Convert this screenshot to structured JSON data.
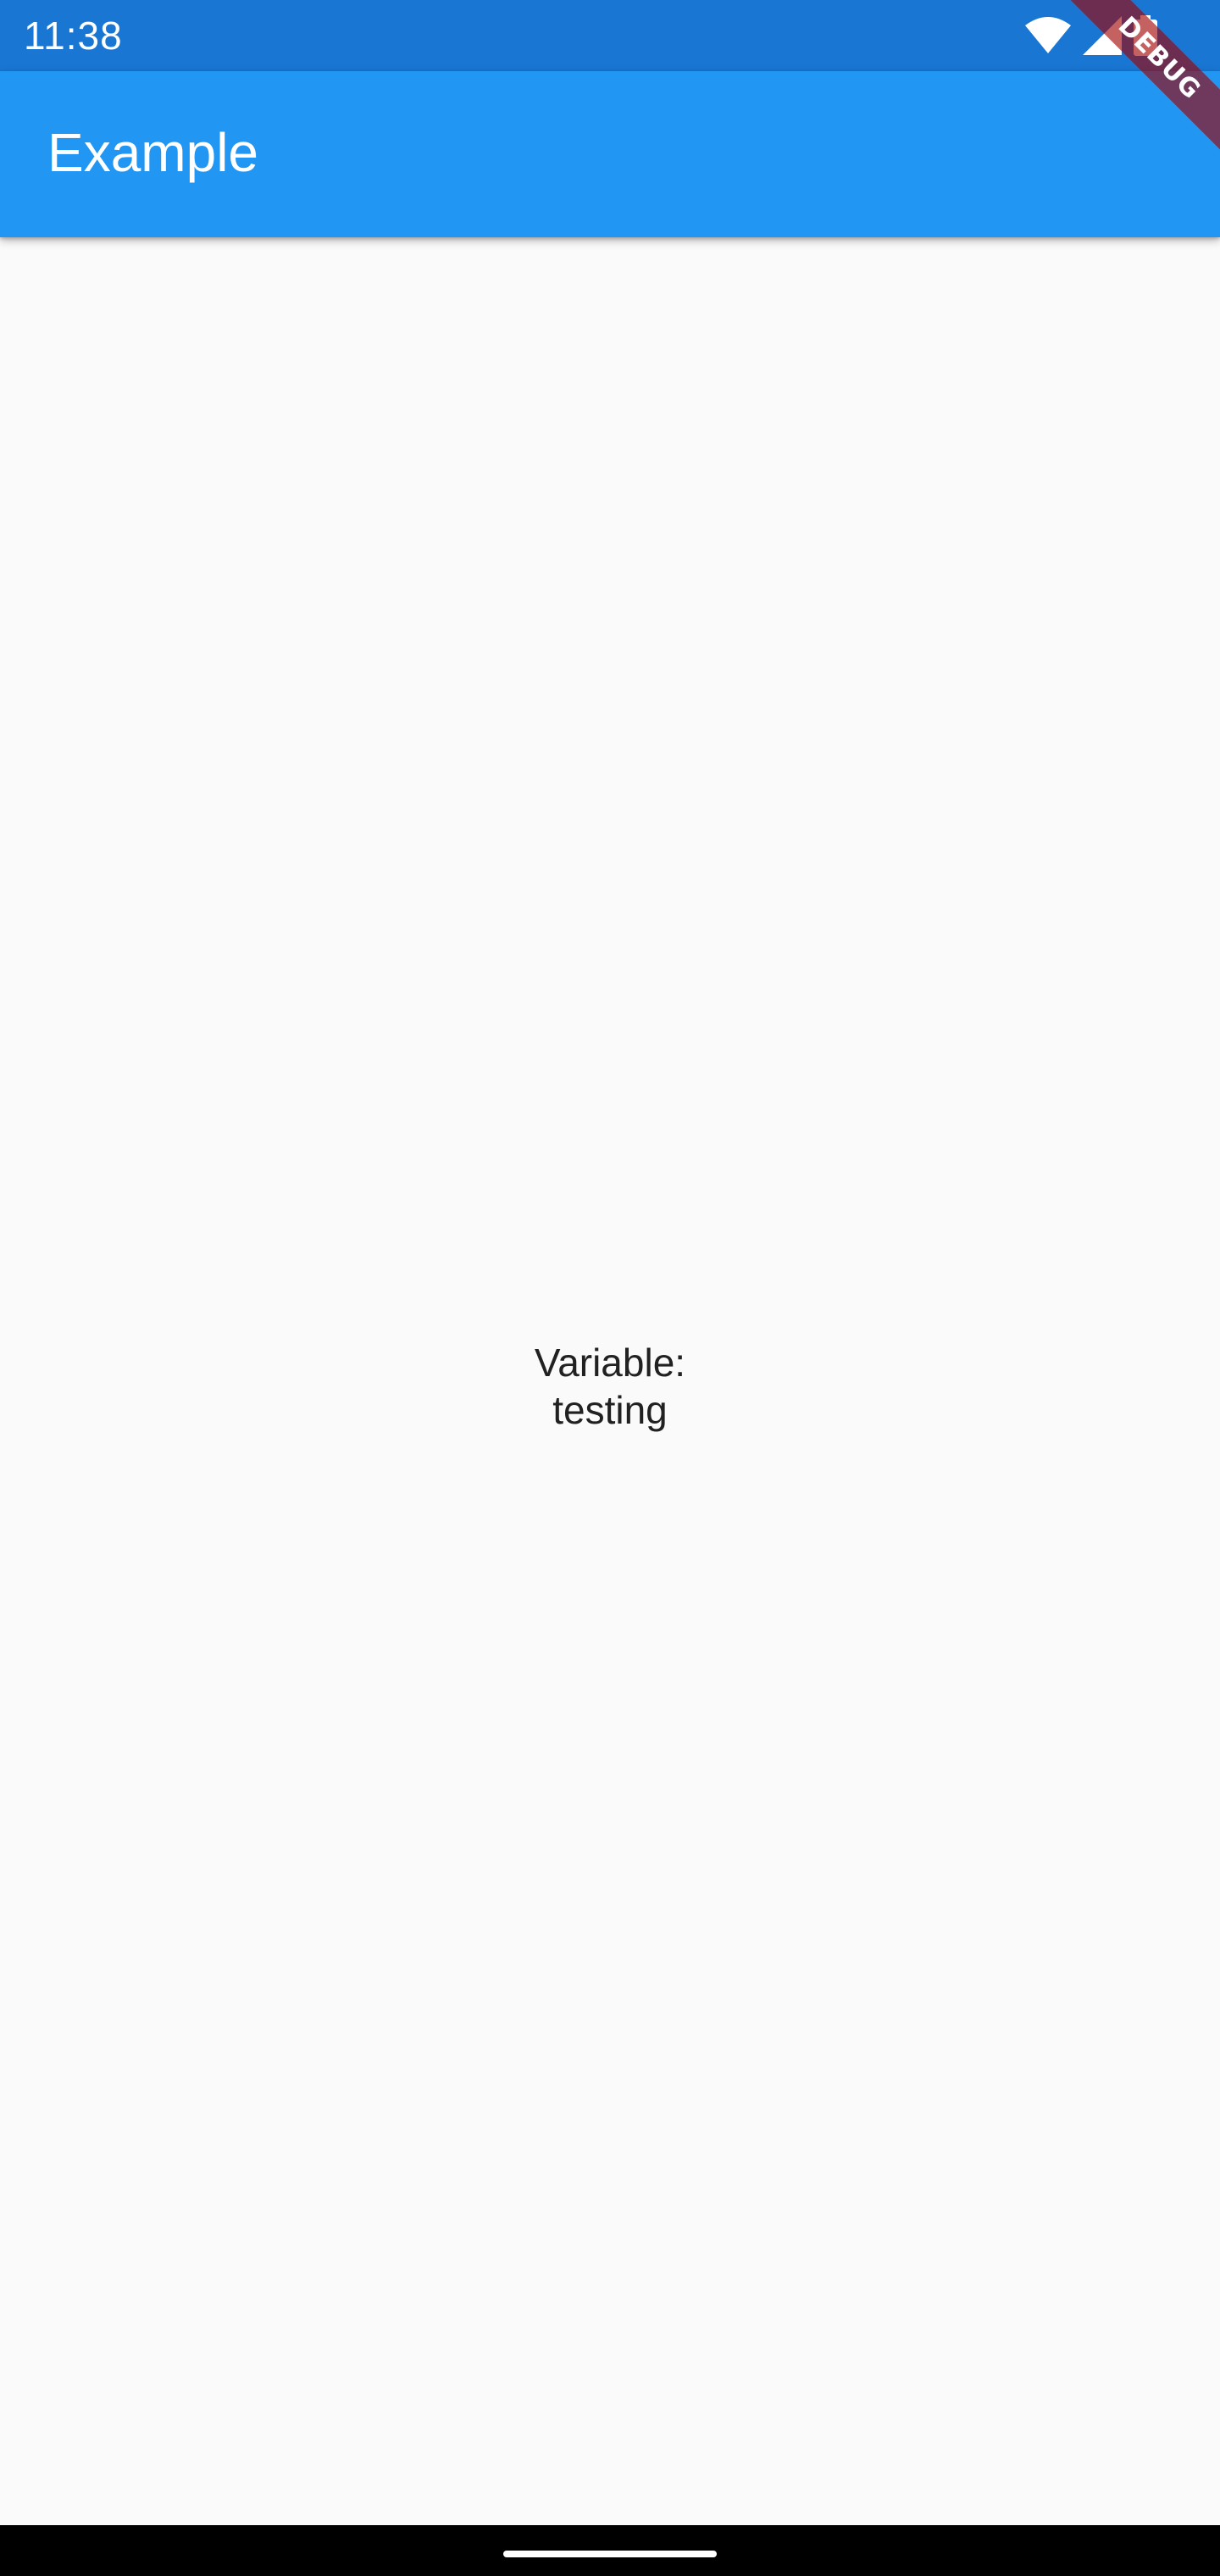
{
  "status_bar": {
    "time": "11:38",
    "background": "#1976d2",
    "icons": [
      "wifi-icon",
      "cellular-signal-icon",
      "battery-icon"
    ]
  },
  "app_bar": {
    "title": "Example",
    "background": "#2196f3"
  },
  "debug_banner": {
    "label": "DEBUG"
  },
  "content": {
    "label": "Variable:",
    "value": "testing"
  },
  "colors": {
    "page_background": "#fafafa",
    "text": "#212121"
  }
}
